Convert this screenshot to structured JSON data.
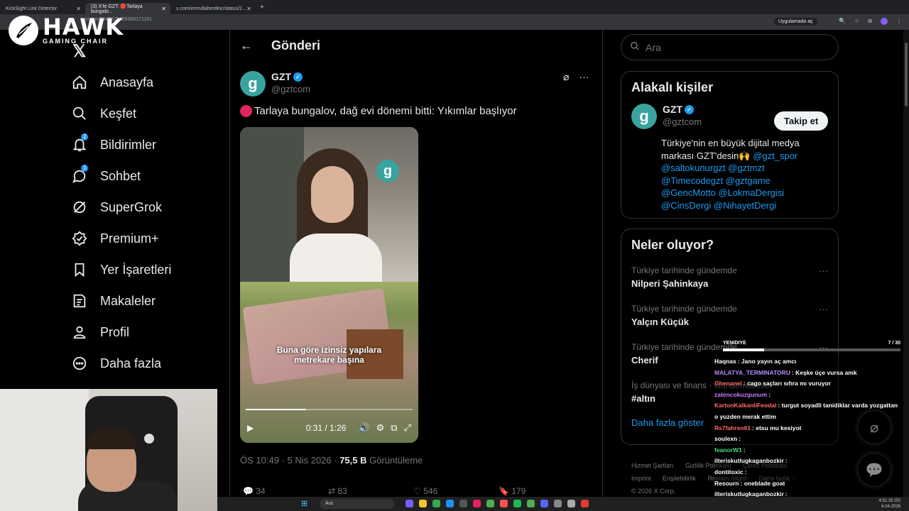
{
  "browser": {
    "tabs": [
      {
        "label": "KickSight Link Detector"
      },
      {
        "label": "(3) X'te GZT: 🔴Tarlaya bungalo..."
      },
      {
        "label": "x.com/emrullaherdinc/status/2..."
      }
    ],
    "url": "status/2040879429300171161",
    "app_button": "Uygulamada aç"
  },
  "overlay_logo": {
    "title": "HAWK",
    "subtitle": "GAMING CHAIR"
  },
  "nav": {
    "items": [
      {
        "label": "Anasayfa",
        "icon": "home-icon"
      },
      {
        "label": "Keşfet",
        "icon": "search-icon"
      },
      {
        "label": "Bildirimler",
        "icon": "bell-icon",
        "badge": "2"
      },
      {
        "label": "Sohbet",
        "icon": "chat-icon",
        "badge": "1"
      },
      {
        "label": "SuperGrok",
        "icon": "grok-icon"
      },
      {
        "label": "Premium+",
        "icon": "verified-icon"
      },
      {
        "label": "Yer İşaretleri",
        "icon": "bookmark-icon"
      },
      {
        "label": "Makaleler",
        "icon": "article-icon"
      },
      {
        "label": "Profil",
        "icon": "profile-icon"
      },
      {
        "label": "Daha fazla",
        "icon": "more-icon"
      }
    ]
  },
  "post": {
    "header": "Gönderi",
    "author_name": "GZT",
    "author_handle": "@gztcom",
    "text": "Tarlaya bungalov, dağ evi dönemi bitti: Yıkımlar başlıyor",
    "video_caption_1": "Buna göre izinsiz yapılara",
    "video_caption_2": "metrekare başına",
    "video_time": "0:31 / 1:26",
    "progress": 0.36,
    "meta_time": "ÖS 10:49 · 5 Nis 2026 · ",
    "views": "75,5 B",
    "views_label": " Görüntüleme",
    "actions": {
      "replies": "34",
      "reposts": "83",
      "likes": "546",
      "bookmarks": "179"
    }
  },
  "right": {
    "search_placeholder": "Ara",
    "related_title": "Alakalı kişiler",
    "related_name": "GZT",
    "related_handle": "@gztcom",
    "follow_label": "Takip et",
    "bio_text": "Türkiye'nin en büyük dijital medya markası GZT'desin🙌 ",
    "bio_links": "@gzt_spor @saltokunurgzt @gztmzt @Timecodegzt @gztgame @GencMotto @LokmaDergisi @CinsDergi @NihayetDergi",
    "trends_title": "Neler oluyor?",
    "trends": [
      {
        "category": "Türkiye tarihinde gündemde",
        "title": "Nilperi Şahinkaya"
      },
      {
        "category": "Türkiye tarihinde gündemde",
        "title": "Yalçın Küçük"
      },
      {
        "category": "Türkiye tarihinde gündemde",
        "title": "Cherif"
      },
      {
        "category": "İş dünyası ve finans · Gündemdekiler",
        "title": "#altın"
      }
    ],
    "show_more": "Daha fazla göster",
    "footer": [
      "Hizmet Şartları",
      "Gizlilik Politikası",
      "Çerez Politikası",
      "Imprint",
      "Erişilebilirlik",
      "Reklam bilgisi",
      "Daha fazla ···",
      "© 2026 X Corp."
    ]
  },
  "stream_overlay": {
    "bar_label": "YENIDIYE",
    "bar_count": "7 / 30",
    "bar_progress": 0.23,
    "chat": [
      {
        "user": "Haqnas",
        "color": "#ffffff",
        "text": "Jano yayın aç amcı"
      },
      {
        "user": "MALATYA_TERMINATORU",
        "color": "#b48cff",
        "text": "Keşke üçe vursa amk"
      },
      {
        "user": "Ghenanel",
        "color": "#ff6b6b",
        "text": "cago saçları sıfıra mı vuruyor"
      },
      {
        "user": "zatencokuzgunum",
        "color": "#c77dff",
        "text": ""
      },
      {
        "user": "KartonKalkanliFeodal",
        "color": "#ff6b6b",
        "text": "turgut soyadli tanidiklar varda yozgattan o yuzden merak ettim"
      },
      {
        "user": "Rs7fahren61",
        "color": "#ff6b6b",
        "text": "etsu mu kesiyot"
      },
      {
        "user": "soulexn",
        "color": "#ffffff",
        "text": ""
      },
      {
        "user": "feanorW1",
        "color": "#4ade80",
        "text": ""
      },
      {
        "user": "ilteriskutlugkaganbozkir",
        "color": "#ffffff",
        "text": ""
      },
      {
        "user": "dontitoxic",
        "color": "#ffffff",
        "text": ""
      },
      {
        "user": "Resourn",
        "color": "#ffffff",
        "text": "oneblade goat"
      },
      {
        "user": "ilteriskutlugkaganbozkir",
        "color": "#ffffff",
        "text": ""
      }
    ]
  },
  "taskbar": {
    "search": "Ara",
    "time": "4:51:25 ÖS",
    "date": "6.04.2026"
  }
}
